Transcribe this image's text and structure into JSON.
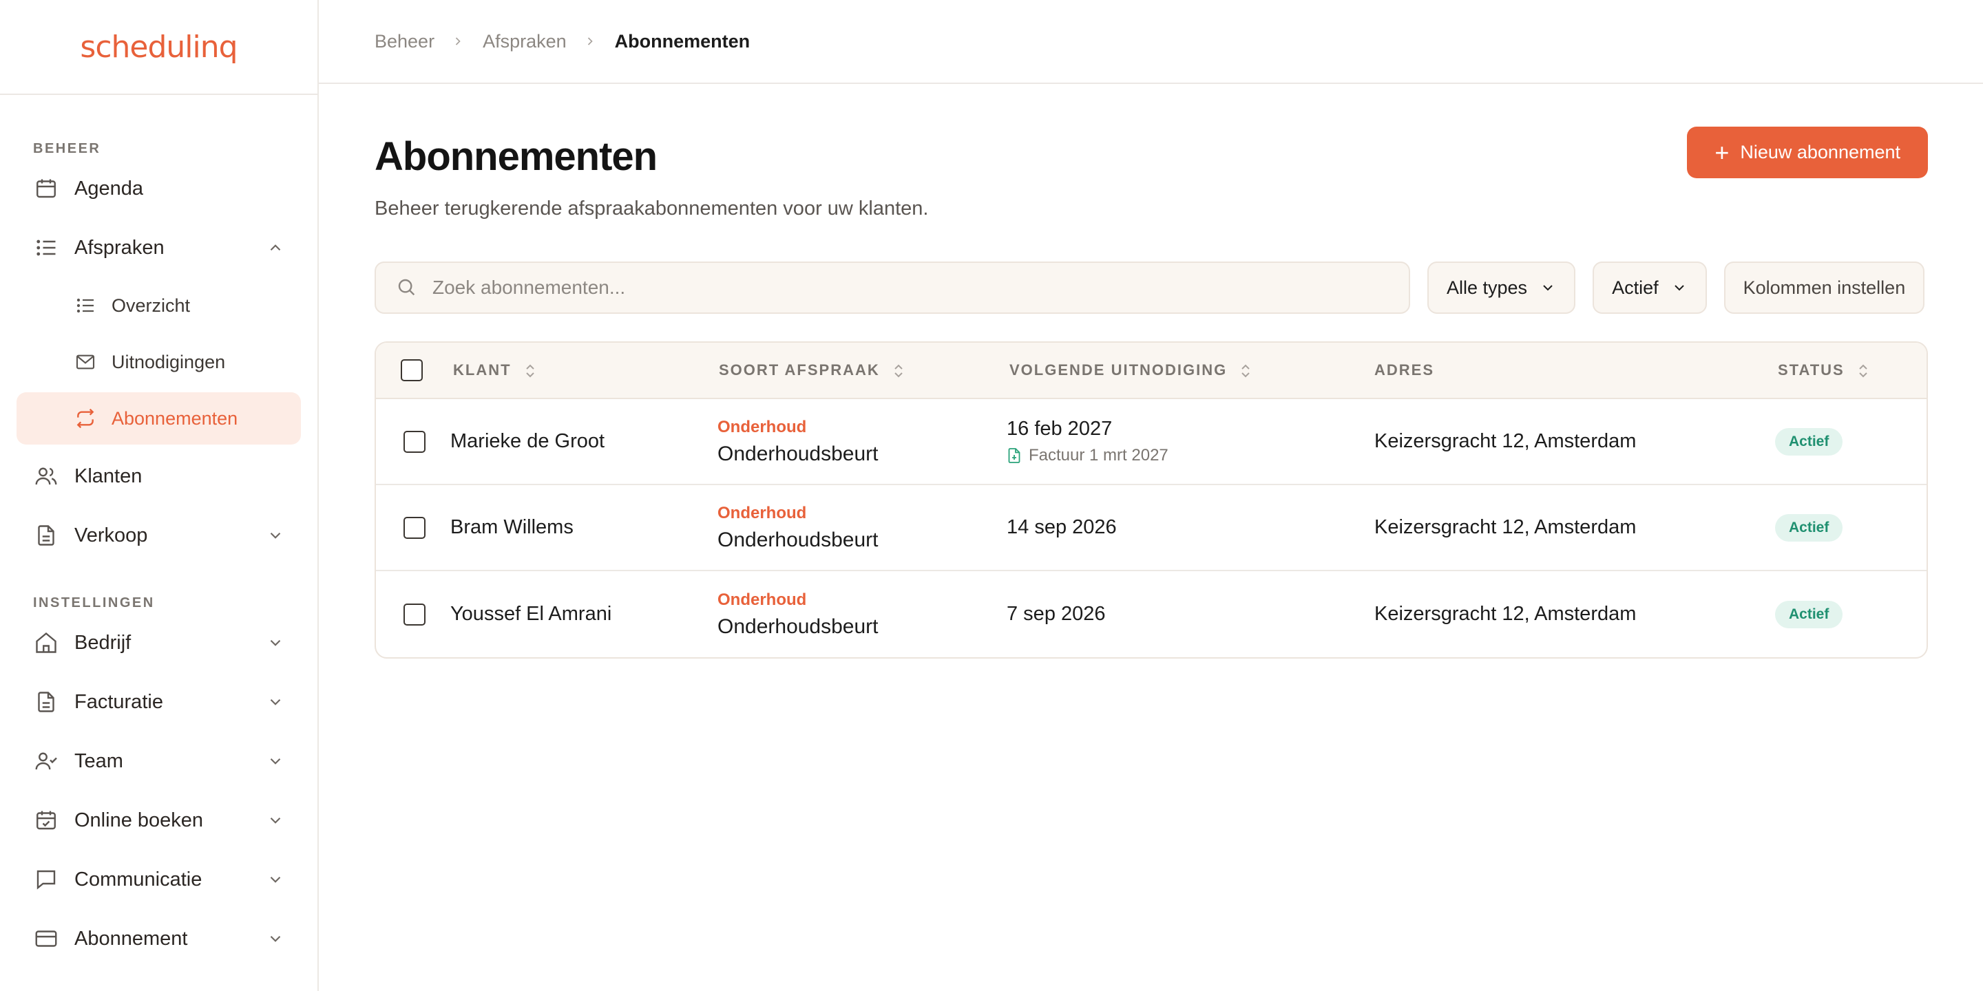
{
  "app": {
    "logo_text": "schedulinq",
    "brand_color": "#e8613a"
  },
  "sidebar": {
    "section_beheer": "BEHEER",
    "section_instellingen": "INSTELLINGEN",
    "items": {
      "agenda": "Agenda",
      "afspraken": "Afspraken",
      "overzicht": "Overzicht",
      "uitnodigingen": "Uitnodigingen",
      "abonnementen": "Abonnementen",
      "klanten": "Klanten",
      "verkoop": "Verkoop",
      "bedrijf": "Bedrijf",
      "facturatie": "Facturatie",
      "team": "Team",
      "online_boeken": "Online boeken",
      "communicatie": "Communicatie",
      "abonnement": "Abonnement"
    }
  },
  "breadcrumb": [
    "Beheer",
    "Afspraken",
    "Abonnementen"
  ],
  "page": {
    "title": "Abonnementen",
    "subtitle": "Beheer terugkerende afspraakabonnementen voor uw klanten.",
    "new_button": "Nieuw abonnement"
  },
  "toolbar": {
    "search_placeholder": "Zoek abonnementen...",
    "type_filter": "Alle types",
    "status_filter": "Actief",
    "columns_button": "Kolommen instellen"
  },
  "table": {
    "headers": {
      "klant": "KLANT",
      "soort": "SOORT AFSPRAAK",
      "volgende": "VOLGENDE UITNODIGING",
      "adres": "ADRES",
      "status": "STATUS"
    },
    "rows": [
      {
        "klant": "Marieke de Groot",
        "type_tag": "Onderhoud",
        "type_name": "Onderhoudsbeurt",
        "next": "16 feb 2027",
        "invoice": "Factuur 1 mrt 2027",
        "address": "Keizersgracht 12, Amsterdam",
        "status": "Actief"
      },
      {
        "klant": "Bram Willems",
        "type_tag": "Onderhoud",
        "type_name": "Onderhoudsbeurt",
        "next": "14 sep 2026",
        "address": "Keizersgracht 12, Amsterdam",
        "status": "Actief"
      },
      {
        "klant": "Youssef El Amrani",
        "type_tag": "Onderhoud",
        "type_name": "Onderhoudsbeurt",
        "next": "7 sep 2026",
        "address": "Keizersgracht 12, Amsterdam",
        "status": "Actief"
      }
    ]
  }
}
